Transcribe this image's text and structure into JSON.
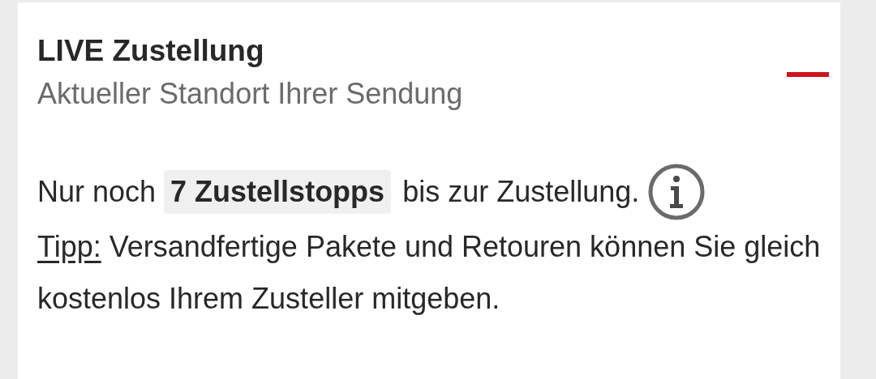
{
  "card": {
    "title": "LIVE Zustellung",
    "subtitle": "Aktueller Standort Ihrer Sendung",
    "expanded": true,
    "stops": {
      "before": "Nur noch",
      "highlight": "7 Zustellstopps",
      "after": "bis zur Zustellung."
    },
    "tip": {
      "label": "Tipp:",
      "text": "Versandfertige Pakete und Retouren können Sie gleich kostenlos Ihrem Zusteller mitgeben."
    }
  }
}
